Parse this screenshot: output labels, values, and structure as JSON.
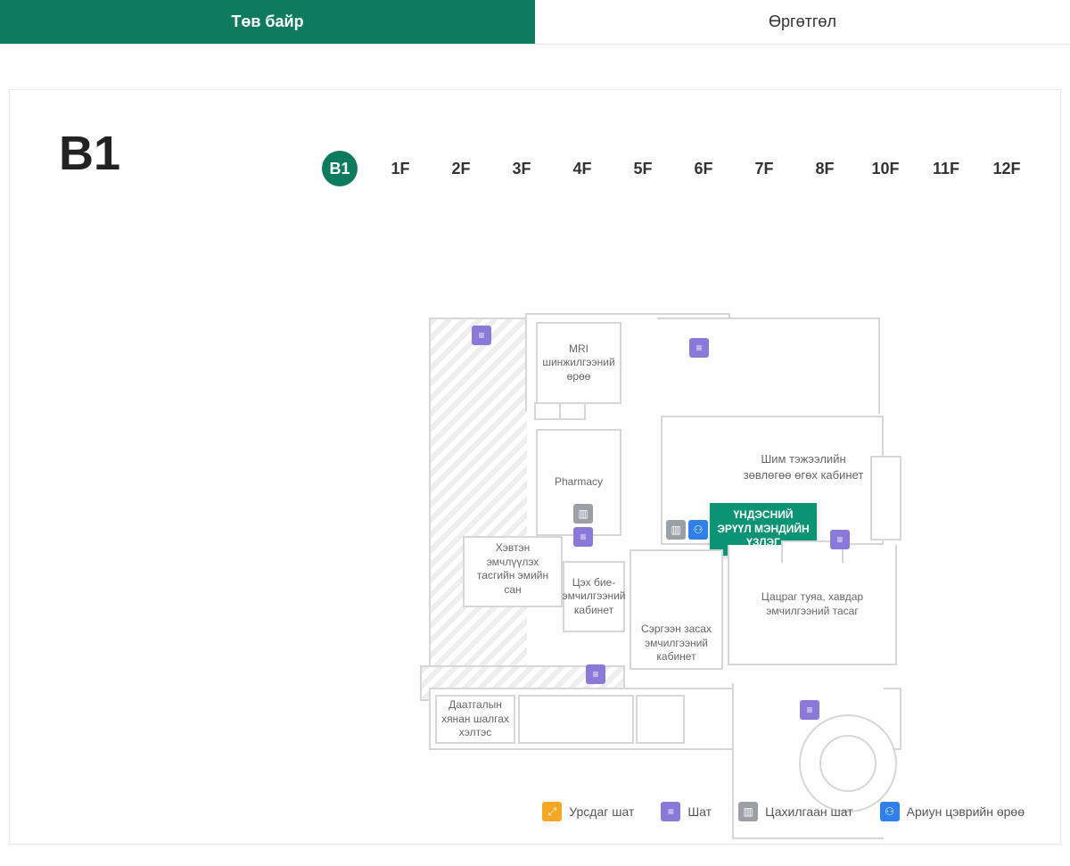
{
  "tabs": {
    "main": "Төв байр",
    "ext": "Өргөтгөл",
    "active": "main"
  },
  "currentFloor": "B1",
  "floors": [
    "B1",
    "1F",
    "2F",
    "3F",
    "4F",
    "5F",
    "6F",
    "7F",
    "8F",
    "10F",
    "11F",
    "12F"
  ],
  "rooms": {
    "mri": "MRI шинжилгээний өрөө",
    "pharmacy": "Pharmacy",
    "nutrition": "Шим тэжээлийн зөвлөгөө өгөх кабинет",
    "inpatient_pharmacy": "Хэвтэн эмчлүүлэх тасгийн эмийн сан",
    "radiology": "Цэх бие-эмчилгээний кабинет",
    "rehab": "Сэргээн засах эмчилгээний кабинет",
    "oncology": "Цацраг туяа, хавдар эмчилгээний тасаг",
    "insurance": "Даатгалын хянан шалгах хэлтэс",
    "highlight": "ҮНДЭСНИЙ ЭРҮҮЛ МЭНДИЙН ҮЗЛЭГ"
  },
  "legend": {
    "esc": "Урсдаг шат",
    "stairs": "Шат",
    "elev": "Цахилгаан шат",
    "wc": "Ариун цэврийн өрөө"
  },
  "icon_glyphs": {
    "stairs": "≡",
    "elev": "▥",
    "wc": "⚇",
    "esc": "⤢"
  }
}
